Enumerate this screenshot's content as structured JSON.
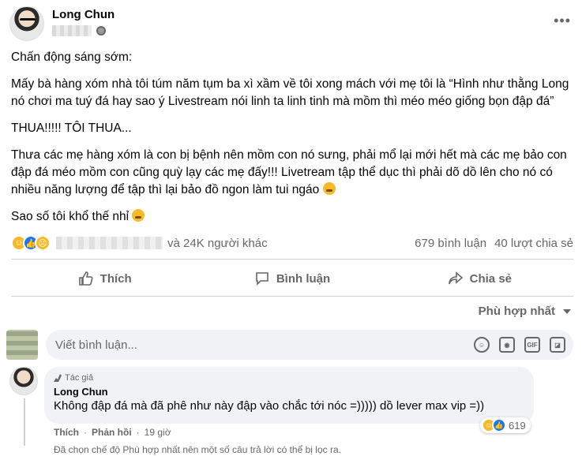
{
  "post": {
    "author": "Long Chun",
    "paragraphs": [
      "Chấn động sáng sớm:",
      "Mấy bà hàng xóm nhà tôi túm năm tụm ba xì xầm về tôi xong mách với mẹ tôi là “Hình như thằng Long nó chơi ma tuý đá hay sao ý Livestream nói linh ta linh tinh mà mồm thì méo méo giống bọn đập đá”",
      "THUA!!!!! TÔI THUA...",
      "Thưa các mẹ hàng xóm là con bị bệnh nên mồm con nó sưng, phải mổ lại mới hết mà các mẹ bảo con đập đá méo mồm con cũng quỳ lạy các mẹ đấy!!! Livetream tập thể dục thì phải dõ dồ lên cho nó có nhiều năng lượng để tập thì lại bảo đồ ngon làm tui ngáo",
      "Sao số tôi khổ thế nhỉ"
    ]
  },
  "stats": {
    "others_text": "và 24K người khác",
    "comments_count": "679 bình luận",
    "shares_count": "40 lượt chia sẻ"
  },
  "actions": {
    "like": "Thích",
    "comment": "Bình luận",
    "share": "Chia sẻ"
  },
  "sort": {
    "label": "Phù hợp nhất"
  },
  "composer": {
    "placeholder": "Viết bình luận...",
    "tools": [
      "emoji-icon",
      "camera-icon",
      "gif-icon",
      "sticker-icon"
    ]
  },
  "comment": {
    "badge": "Tác giả",
    "author": "Long Chun",
    "text": "Không đập đá mà đã phê như này đập vào chắc tới nóc =))))) dồ lever max vip =))",
    "reaction_count": "619",
    "like_label": "Thích",
    "reply_label": "Phản hồi",
    "time": "19 giờ"
  },
  "notice": "Đã chọn chế độ Phù hợp nhất nên một số câu trả lời có thể bị lọc ra.",
  "colors": {
    "like_blue": "#1877f2",
    "haha_yellow": "#f7b928",
    "muted": "#65676b",
    "bubble_bg": "#f0f2f5"
  }
}
